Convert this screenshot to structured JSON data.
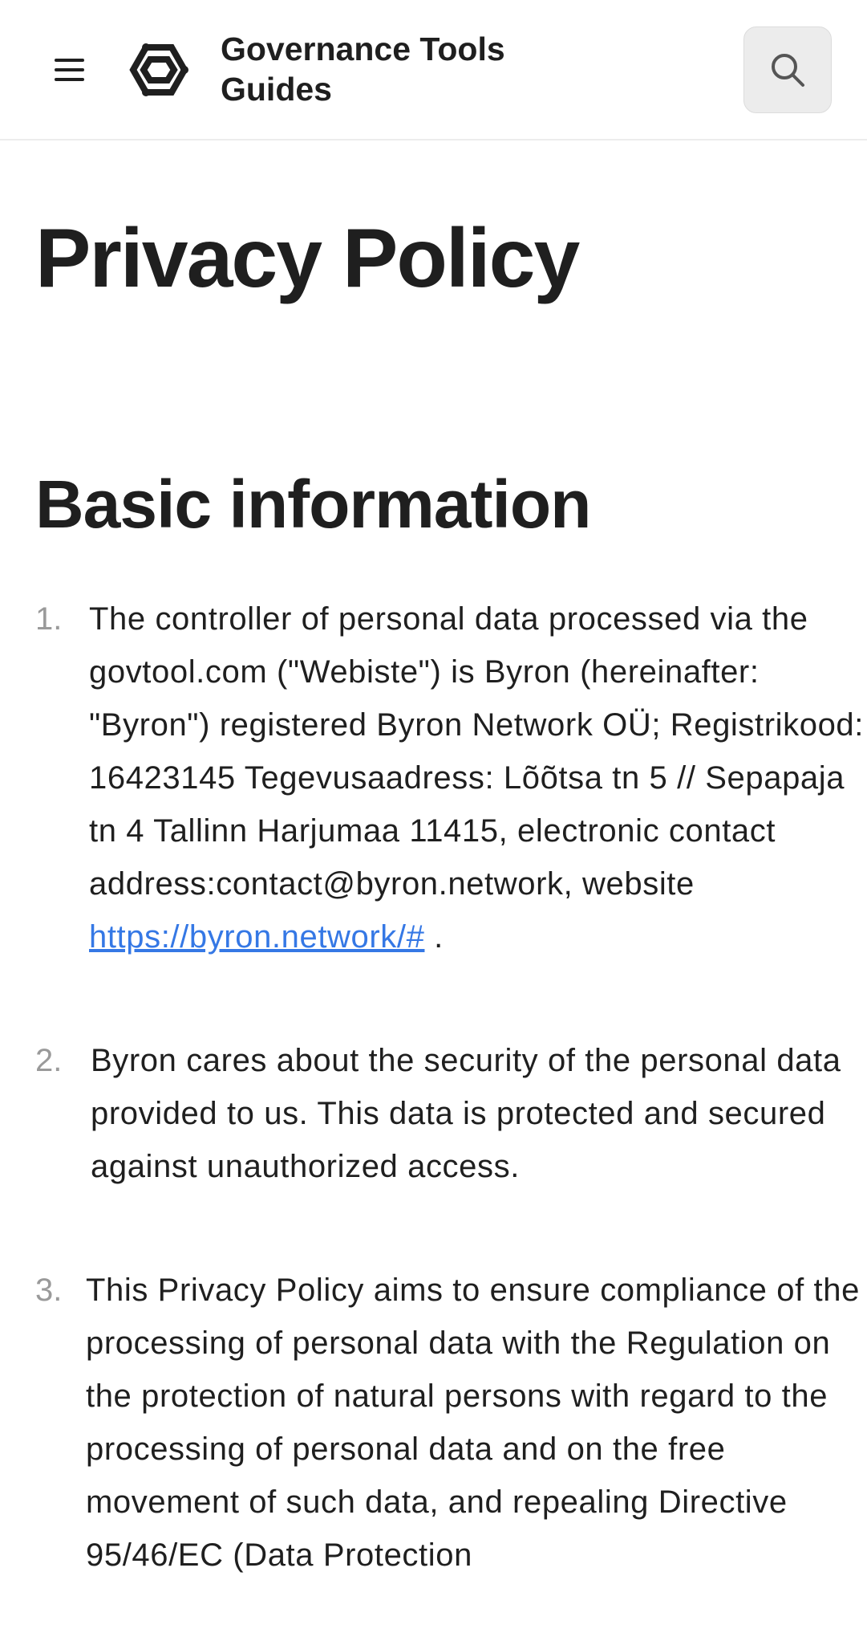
{
  "header": {
    "brand_title": "Governance Tools Guides",
    "menu_icon": "hamburger-menu-icon",
    "logo_icon": "hexagon-logo-icon",
    "search_icon": "search-icon"
  },
  "main": {
    "page_title": "Privacy Policy",
    "section_title": "Basic information",
    "items": [
      {
        "number": "1.",
        "text_before_link": "The controller of personal data processed via the govtool.com (\"Webiste\") is Byron (hereinafter: \"Byron\") registered Byron Network OÜ; Registrikood: 16423145 Tegevusaadress: Lõõtsa tn 5 // Sepapaja tn 4 Tallinn Harjumaa 11415, electronic contact address:contact@byron.network, website ",
        "link_text": "https://byron.network/#",
        "text_after_link": " ."
      },
      {
        "number": "2.",
        "text": "Byron cares about the security of the personal data provided to us. This data is protected and secured against unauthorized access."
      },
      {
        "number": "3.",
        "text": "This Privacy Policy aims to ensure compliance of the processing of personal data with the Regulation on the protection of natural persons with regard to the processing of personal data and on the free movement of such data, and repealing Directive 95/46/EC (Data Protection"
      }
    ]
  },
  "colors": {
    "link": "#3578e5",
    "text": "#1f1f1f",
    "muted": "#9a9a9a",
    "search_bg": "#ececec"
  }
}
